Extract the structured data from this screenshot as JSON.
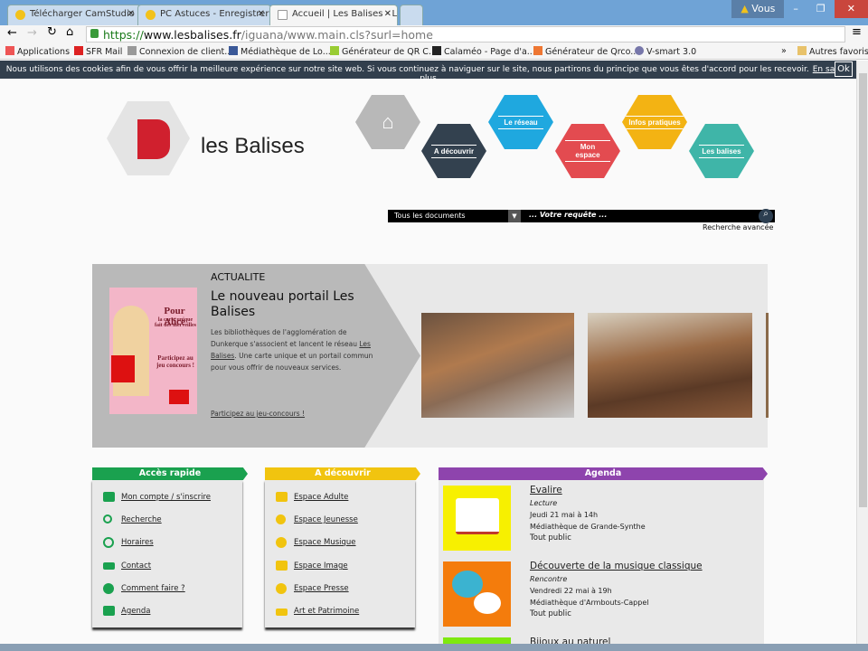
{
  "browser": {
    "tabs": [
      {
        "label": "Télécharger CamStudio -"
      },
      {
        "label": "PC Astuces - Enregistrer"
      },
      {
        "label": "Accueil | Les Balises - Le r"
      }
    ],
    "user": "Vous",
    "url_scheme": "https://",
    "url_host": "www.lesbalises.fr",
    "url_path": "/iguana/www.main.cls?surl=home",
    "bookmarks": [
      "Applications",
      "SFR Mail",
      "Connexion de client...",
      "Médiathèque de Lo...",
      "Générateur de QR C...",
      "Calaméo - Page d'a...",
      "Générateur de Qrco...",
      "V-smart 3.0"
    ],
    "more": "»",
    "other": "Autres favoris"
  },
  "cookie": {
    "text": "Nous utilisons des cookies afin de vous offrir la meilleure expérience sur notre site web. Si vous continuez à naviguer sur le site, nous partirons du principe que vous êtes d'accord pour les recevoir.",
    "link": "En savoir plus",
    "ok": "Ok"
  },
  "site": {
    "logo": "les Balises"
  },
  "nav": [
    {
      "label": "A découvrir",
      "color": "#33414f"
    },
    {
      "label": "Le réseau",
      "color": "#1fa8df"
    },
    {
      "label": "Mon espace",
      "color": "#e34b50"
    },
    {
      "label": "Infos pratiques",
      "color": "#f3b313"
    },
    {
      "label": "Les balises",
      "color": "#3fb5a8"
    }
  ],
  "search": {
    "scope": "Tous les documents",
    "placeholder": "... Votre requête ...",
    "advanced": "Recherche avancée"
  },
  "news": {
    "kicker": "ACTUALITE",
    "title": "Le nouveau portail Les Balises",
    "body_pre": "Les bibliothèques de l'agglomération de Dunkerque s'associent et lancent le réseau ",
    "body_link": "Les Balises",
    "body_post": ". Une carte unique et un portail commun pour vous offrir de nouveaux services.",
    "cta": "Participez au jeu-concours !",
    "poster": {
      "title": "Pour Alice",
      "sub": "la carte unique fait des merveilles",
      "cta": "Participez au jeu concours !"
    }
  },
  "acces": {
    "title": "Accès rapide",
    "color": "#1aa14f",
    "items": [
      "Mon compte / s'inscrire",
      "Recherche",
      "Horaires",
      "Contact",
      "Comment faire ?",
      "Agenda"
    ]
  },
  "decouvrir": {
    "title": "A découvrir",
    "color": "#f1c40f",
    "items": [
      "Espace Adulte",
      "Espace Jeunesse",
      "Espace Musique",
      "Espace Image",
      "Espace Presse",
      "Art et Patrimoine"
    ]
  },
  "agenda": {
    "title": "Agenda",
    "color": "#8e44ad",
    "events": [
      {
        "title": "Evalire",
        "type": "Lecture",
        "date": "Jeudi 21 mai à 14h",
        "place": "Médiathèque de Grande-Synthe",
        "audience": "Tout public",
        "color": "#f7f000"
      },
      {
        "title": "Découverte de la musique classique",
        "type": "Rencontre",
        "date": "Vendredi 22 mai à 19h",
        "place": "Médiathèque d'Armbouts-Cappel",
        "audience": "Tout public",
        "color": "#f47c0c"
      },
      {
        "title": "Bijoux au naturel",
        "color": "#7ee80f"
      }
    ]
  }
}
